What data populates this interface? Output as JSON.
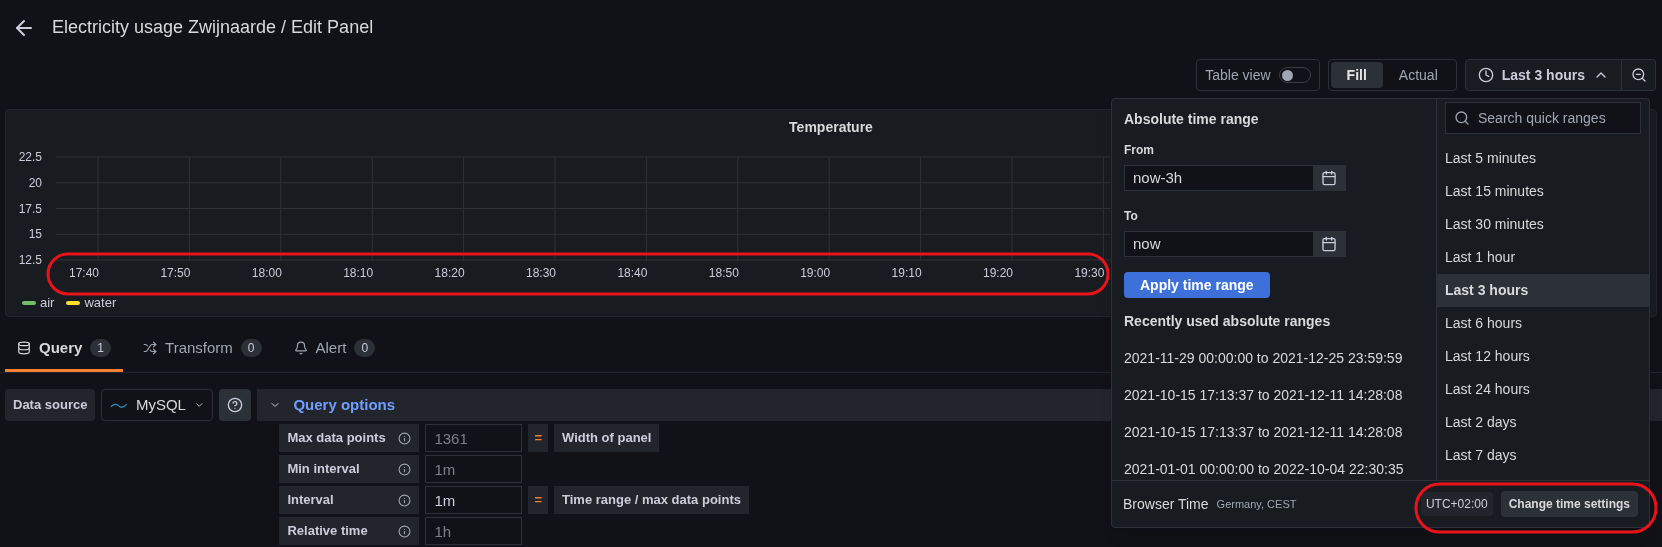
{
  "header": {
    "title": "Electricity usage Zwijnaarde / Edit Panel"
  },
  "toolbar": {
    "table_view": {
      "label": "Table view",
      "on": false
    },
    "size_modes": [
      {
        "label": "Fill",
        "selected": true
      },
      {
        "label": "Actual",
        "selected": false
      }
    ],
    "time_picker": {
      "label": "Last 3 hours",
      "expanded": true
    }
  },
  "panel": {
    "chart_data": {
      "type": "line",
      "title": "Temperature",
      "categories": [
        "17:40",
        "17:50",
        "18:00",
        "18:10",
        "18:20",
        "18:30",
        "18:40",
        "18:50",
        "19:00",
        "19:10",
        "19:20",
        "19:30"
      ],
      "yticks": [
        12.5,
        15,
        17.5,
        20,
        22.5
      ],
      "ylim": [
        12.5,
        22.5
      ],
      "grid": true
    },
    "legend": [
      {
        "name": "air",
        "color": "#73bf69"
      },
      {
        "name": "water",
        "color": "#fade2a"
      }
    ]
  },
  "editor_tabs": [
    {
      "label": "Query",
      "count": "1",
      "selected": true
    },
    {
      "label": "Transform",
      "count": "0",
      "selected": false
    },
    {
      "label": "Alert",
      "count": "0",
      "selected": false
    }
  ],
  "query": {
    "data_source_label": "Data source",
    "data_source": "MySQL",
    "options_title": "Query options",
    "options": [
      {
        "label": "Max data points",
        "placeholder": "1361",
        "equals": "=",
        "note": "Width of panel"
      },
      {
        "label": "Min interval",
        "placeholder": "1m"
      },
      {
        "label": "Interval",
        "value": "1m",
        "equals": "=",
        "note": "Time range / max data points"
      },
      {
        "label": "Relative time",
        "placeholder": "1h"
      }
    ]
  },
  "time_range_popup": {
    "title": "Absolute time range",
    "from_label": "From",
    "from_value": "now-3h",
    "to_label": "To",
    "to_value": "now",
    "apply": "Apply time range",
    "recent_title": "Recently used absolute ranges",
    "recent": [
      "2021-11-29 00:00:00 to 2021-12-25 23:59:59",
      "2021-10-15 17:13:37 to 2021-12-11 14:28:08",
      "2021-10-15 17:13:37 to 2021-12-11 14:28:08",
      "2021-01-01 00:00:00 to 2022-10-04 22:30:35"
    ],
    "search_placeholder": "Search quick ranges",
    "quick_ranges": [
      {
        "label": "Last 5 minutes",
        "selected": false
      },
      {
        "label": "Last 15 minutes",
        "selected": false
      },
      {
        "label": "Last 30 minutes",
        "selected": false
      },
      {
        "label": "Last 1 hour",
        "selected": false
      },
      {
        "label": "Last 3 hours",
        "selected": true
      },
      {
        "label": "Last 6 hours",
        "selected": false
      },
      {
        "label": "Last 12 hours",
        "selected": false
      },
      {
        "label": "Last 24 hours",
        "selected": false
      },
      {
        "label": "Last 2 days",
        "selected": false
      },
      {
        "label": "Last 7 days",
        "selected": false
      }
    ],
    "footer": {
      "label": "Browser Time",
      "location": "Germany, CEST",
      "offset": "UTC+02:00",
      "button": "Change time settings"
    }
  },
  "annotations": [
    {
      "kind": "ellipse"
    },
    {
      "kind": "ellipse"
    }
  ]
}
